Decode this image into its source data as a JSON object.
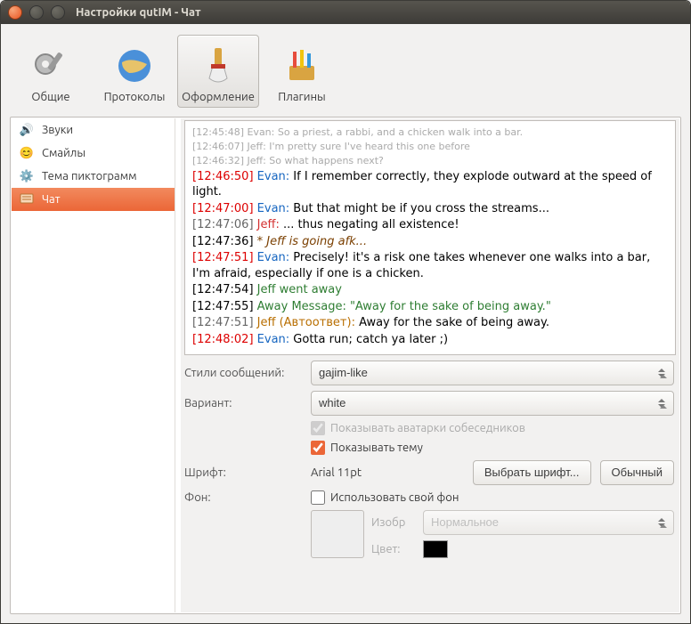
{
  "window": {
    "title": "Настройки qutIM - Чат"
  },
  "toolbar": {
    "items": [
      {
        "label": "Общие"
      },
      {
        "label": "Протоколы"
      },
      {
        "label": "Оформление"
      },
      {
        "label": "Плагины"
      }
    ]
  },
  "sidebar": {
    "items": [
      {
        "label": "Звуки"
      },
      {
        "label": "Смайлы"
      },
      {
        "label": "Тема пиктограмм"
      },
      {
        "label": "Чат"
      }
    ]
  },
  "preview": {
    "lines": [
      {
        "ts": "[12:45:48]",
        "who": "Evan:",
        "body": "So a priest, a rabbi, and a chicken walk into a bar.",
        "hist": true,
        "kind": "evan"
      },
      {
        "ts": "[12:46:07]",
        "who": "Jeff:",
        "body": "I'm pretty sure I've heard this one before",
        "hist": true,
        "kind": "jeff"
      },
      {
        "ts": "[12:46:32]",
        "who": "Jeff:",
        "body": "So what happens next?",
        "hist": true,
        "kind": "jeff"
      },
      {
        "ts": "[12:46:50]",
        "who": "Evan:",
        "body": "If I remember correctly, they explode outward at the speed of light.",
        "kind": "evan",
        "tsc": "tsE"
      },
      {
        "ts": "[12:47:00]",
        "who": "Evan:",
        "body": "But that might be if you cross the streams...",
        "kind": "evan",
        "tsc": "tsE"
      },
      {
        "ts": "[12:47:06]",
        "who": "Jeff:",
        "body": "... thus negating all existence!",
        "kind": "jeff",
        "tsc": "tsJ"
      },
      {
        "ts": "[12:47:36]",
        "who": "",
        "body": "* Jeff is going afk...",
        "kind": "action",
        "tsc": "ts"
      },
      {
        "ts": "[12:47:51]",
        "who": "Evan:",
        "body": "Precisely! it's a risk one takes whenever one walks into a bar, I'm afraid, especially if one is a chicken.",
        "kind": "evan",
        "tsc": "tsE"
      },
      {
        "ts": "[12:47:54]",
        "who": "",
        "body": "Jeff went away",
        "kind": "sys",
        "tsc": "ts"
      },
      {
        "ts": "[12:47:55]",
        "who": "",
        "body": "Away Message: \"Away for the sake of being away.\"",
        "kind": "sys",
        "tsc": "ts"
      },
      {
        "ts": "[12:47:51]",
        "who": "Jeff (Автоответ):",
        "body": "Away for the sake of being away.",
        "kind": "auto",
        "tsc": "tsJ"
      },
      {
        "ts": "[12:48:02]",
        "who": "Evan:",
        "body": "Gotta run; catch ya later ;)",
        "kind": "evan",
        "tsc": "tsE"
      }
    ]
  },
  "form": {
    "style_label": "Стили сообщений:",
    "style_value": "gajim-like",
    "variant_label": "Вариант:",
    "variant_value": "white",
    "show_avatars": "Показывать аватарки собеседников",
    "show_topic": "Показывать тему",
    "font_label": "Шрифт:",
    "font_value": "Arial 11pt",
    "choose_font": "Выбрать шрифт...",
    "default_btn": "Обычный",
    "bg_label": "Фон:",
    "use_custom_bg": "Использовать свой фон",
    "image_label": "Изобр",
    "image_mode": "Нормальное",
    "color_label": "Цвет:"
  }
}
